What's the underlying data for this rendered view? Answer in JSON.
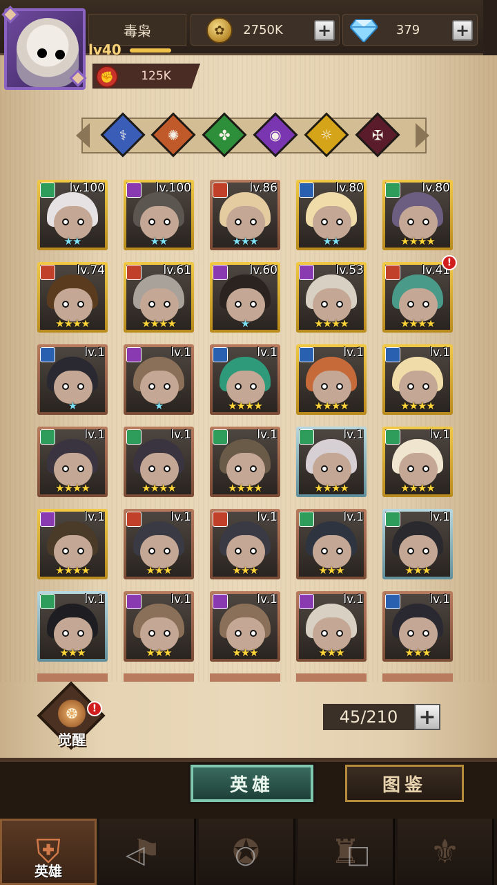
{
  "player": {
    "name": "毒枭",
    "level": "lv40",
    "gold": "2750K",
    "diamonds": "379",
    "power": "125K"
  },
  "filters": [
    {
      "icon": "crossed-swords-icon",
      "glyph": "⚕",
      "color": "#3a5db8"
    },
    {
      "icon": "sun-icon",
      "glyph": "✺",
      "color": "#c05a2a"
    },
    {
      "icon": "clover-icon",
      "glyph": "✤",
      "color": "#2e8f3a"
    },
    {
      "icon": "eye-icon",
      "glyph": "◉",
      "color": "#7a36b0"
    },
    {
      "icon": "light-eye-icon",
      "glyph": "☼",
      "color": "#d6a418"
    },
    {
      "icon": "dark-rune-icon",
      "glyph": "✠",
      "color": "#5a1c2a"
    }
  ],
  "heroes": [
    {
      "lv": "lv.100",
      "frame": "gold",
      "cls": "#2e9c5a",
      "stars": "★★",
      "starColor": "c",
      "hair": "#e6e2e4"
    },
    {
      "lv": "lv.100",
      "frame": "gold",
      "cls": "#8a3ab0",
      "stars": "★★",
      "starColor": "c",
      "hair": "#5b5650"
    },
    {
      "lv": "lv.86",
      "frame": "copper",
      "cls": "#c0402a",
      "stars": "★★★",
      "starColor": "c",
      "hair": "#e4cca0"
    },
    {
      "lv": "lv.80",
      "frame": "gold",
      "cls": "#2a60b0",
      "stars": "★★",
      "starColor": "c",
      "hair": "#f0dca8"
    },
    {
      "lv": "lv.80",
      "frame": "gold",
      "cls": "#2e9c5a",
      "stars": "★★★★",
      "starColor": "y",
      "hair": "#6b5e80"
    },
    {
      "lv": "lv.74",
      "frame": "gold",
      "cls": "#c0402a",
      "stars": "★★★★",
      "starColor": "y",
      "hair": "#5a3b1e"
    },
    {
      "lv": "lv.61",
      "frame": "gold",
      "cls": "#c0402a",
      "stars": "★★★★",
      "starColor": "y",
      "hair": "#a9a29a"
    },
    {
      "lv": "lv.60",
      "frame": "gold",
      "cls": "#8a3ab0",
      "stars": "★",
      "starColor": "c",
      "hair": "#2a2320"
    },
    {
      "lv": "lv.53",
      "frame": "gold",
      "cls": "#8a3ab0",
      "stars": "★★★★",
      "starColor": "y",
      "hair": "#d8d0c2"
    },
    {
      "lv": "lv.41",
      "frame": "gold",
      "cls": "#c0402a",
      "stars": "★★★★",
      "starColor": "y",
      "hair": "#4a9a8a",
      "alert": "!"
    },
    {
      "lv": "lv.1",
      "frame": "copper",
      "cls": "#2a60b0",
      "stars": "★",
      "starColor": "c",
      "hair": "#2a2830"
    },
    {
      "lv": "lv.1",
      "frame": "copper",
      "cls": "#8a3ab0",
      "stars": "★",
      "starColor": "c",
      "hair": "#8a7058"
    },
    {
      "lv": "lv.1",
      "frame": "copper",
      "cls": "#2a60b0",
      "stars": "★★★★",
      "starColor": "y",
      "hair": "#2e9a7a"
    },
    {
      "lv": "lv.1",
      "frame": "gold",
      "cls": "#2a60b0",
      "stars": "★★★★",
      "starColor": "y",
      "hair": "#c76a3a"
    },
    {
      "lv": "lv.1",
      "frame": "gold",
      "cls": "#2a60b0",
      "stars": "★★★★",
      "starColor": "y",
      "hair": "#f0dca8"
    },
    {
      "lv": "lv.1",
      "frame": "copper",
      "cls": "#2e9c5a",
      "stars": "★★★★",
      "starColor": "y",
      "hair": "#3a3440"
    },
    {
      "lv": "lv.1",
      "frame": "copper",
      "cls": "#2e9c5a",
      "stars": "★★★★",
      "starColor": "y",
      "hair": "#3a3440"
    },
    {
      "lv": "lv.1",
      "frame": "copper",
      "cls": "#2e9c5a",
      "stars": "★★★★",
      "starColor": "y",
      "hair": "#6a5a48"
    },
    {
      "lv": "lv.1",
      "frame": "blue",
      "cls": "#2e9c5a",
      "stars": "★★★★",
      "starColor": "y",
      "hair": "#d6d0d4"
    },
    {
      "lv": "lv.1",
      "frame": "gold",
      "cls": "#2e9c5a",
      "stars": "★★★★",
      "starColor": "y",
      "hair": "#f0e6d0"
    },
    {
      "lv": "lv.1",
      "frame": "gold",
      "cls": "#8a3ab0",
      "stars": "★★★★",
      "starColor": "y",
      "hair": "#4a3a28"
    },
    {
      "lv": "lv.1",
      "frame": "copper",
      "cls": "#c0402a",
      "stars": "★★★",
      "starColor": "y",
      "hair": "#3a3a44"
    },
    {
      "lv": "lv.1",
      "frame": "copper",
      "cls": "#c0402a",
      "stars": "★★★",
      "starColor": "y",
      "hair": "#3a3a44"
    },
    {
      "lv": "lv.1",
      "frame": "copper",
      "cls": "#2e9c5a",
      "stars": "★★★",
      "starColor": "y",
      "hair": "#2e3440"
    },
    {
      "lv": "lv.1",
      "frame": "blue",
      "cls": "#2e9c5a",
      "stars": "★★★",
      "starColor": "y",
      "hair": "#2a2a2e"
    },
    {
      "lv": "lv.1",
      "frame": "blue",
      "cls": "#2e9c5a",
      "stars": "★★★",
      "starColor": "y",
      "hair": "#1e1e22"
    },
    {
      "lv": "lv.1",
      "frame": "copper",
      "cls": "#8a3ab0",
      "stars": "★★★",
      "starColor": "y",
      "hair": "#8a7058"
    },
    {
      "lv": "lv.1",
      "frame": "copper",
      "cls": "#8a3ab0",
      "stars": "★★★",
      "starColor": "y",
      "hair": "#8a7058"
    },
    {
      "lv": "lv.1",
      "frame": "copper",
      "cls": "#8a3ab0",
      "stars": "★★★",
      "starColor": "y",
      "hair": "#d8d0c2"
    },
    {
      "lv": "lv.1",
      "frame": "copper",
      "cls": "#2a60b0",
      "stars": "★★★",
      "starColor": "y",
      "hair": "#2a2830"
    }
  ],
  "awaken": {
    "label": "觉醒",
    "alert": "!"
  },
  "capacity": "45/210",
  "tabs": {
    "heroes": "英雄",
    "codex": "图鉴"
  },
  "nav": [
    {
      "label": "英雄",
      "icon": "helmet-icon",
      "glyph": "⛨",
      "active": true
    },
    {
      "label": "",
      "icon": "banner-icon",
      "glyph": "⚑",
      "active": false
    },
    {
      "label": "",
      "icon": "crown-star-icon",
      "glyph": "✪",
      "active": false
    },
    {
      "label": "",
      "icon": "castle-icon",
      "glyph": "♜",
      "active": false
    },
    {
      "label": "",
      "icon": "handshake-emblem-icon",
      "glyph": "⚜",
      "active": false
    }
  ],
  "colors": {
    "accent_gold": "#f1c945",
    "active_tab": "#3a6a5e",
    "alert": "#d11d1d"
  }
}
